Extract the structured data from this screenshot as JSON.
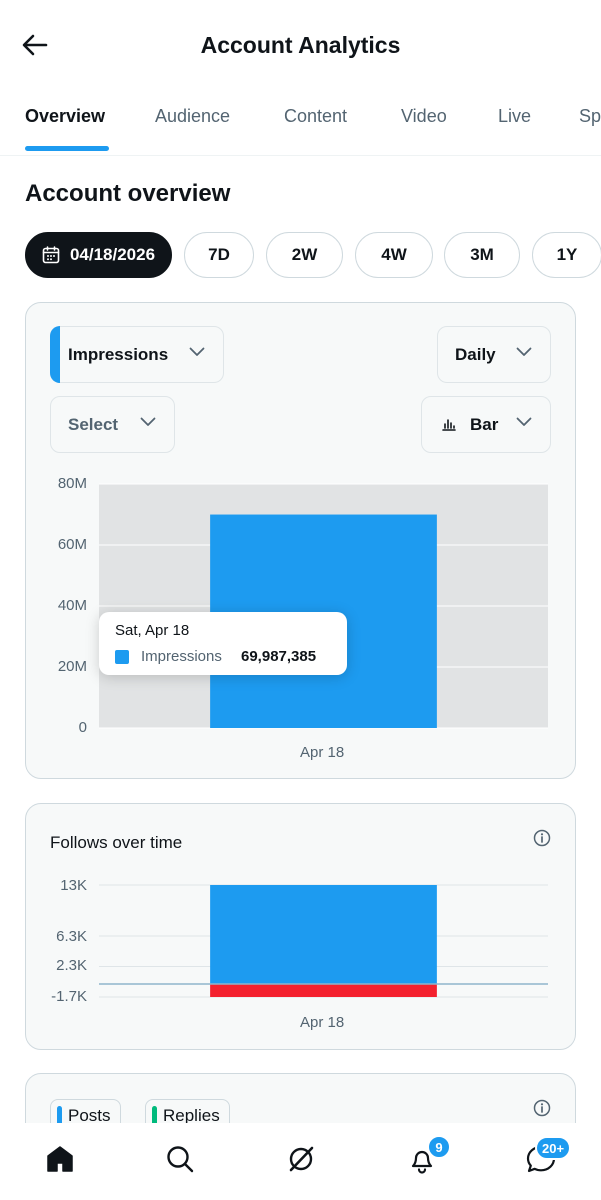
{
  "header": {
    "title": "Account Analytics",
    "back_icon": "arrow-left-icon"
  },
  "tabs": [
    {
      "label": "Overview",
      "active": true
    },
    {
      "label": "Audience",
      "active": false
    },
    {
      "label": "Content",
      "active": false
    },
    {
      "label": "Video",
      "active": false
    },
    {
      "label": "Live",
      "active": false
    },
    {
      "label": "Sp",
      "active": false
    }
  ],
  "section_title": "Account overview",
  "ranges": [
    {
      "label": "04/18/2026",
      "icon": "calendar-icon",
      "active": true
    },
    {
      "label": "7D",
      "active": false
    },
    {
      "label": "2W",
      "active": false
    },
    {
      "label": "4W",
      "active": false
    },
    {
      "label": "3M",
      "active": false
    },
    {
      "label": "1Y",
      "active": false
    }
  ],
  "overview_card": {
    "metric_select": "Impressions",
    "interval_select": "Daily",
    "compare_select": "Select",
    "chart_type_select": "Bar",
    "tooltip": {
      "date": "Sat, Apr 18",
      "series": "Impressions",
      "value": "69,987,385"
    }
  },
  "follows_card": {
    "title": "Follows over time",
    "info_icon": "info-icon"
  },
  "posts_card": {
    "legend": [
      "Posts",
      "Replies"
    ],
    "info_icon": "info-icon"
  },
  "colors": {
    "accent": "#1d9bf0",
    "negative": "#f4212e",
    "text": "#0f1419",
    "muted": "#536471",
    "plot_bg": "#e1e3e4",
    "posts": "#1d9bf0",
    "replies": "#00ba7c"
  },
  "chart_data": [
    {
      "type": "bar",
      "categories": [
        "Apr 18"
      ],
      "series": [
        {
          "name": "Impressions",
          "values": [
            69987385
          ]
        }
      ],
      "yticks": [
        "80M",
        "60M",
        "40M",
        "20M",
        "0"
      ],
      "ylim": [
        0,
        80000000
      ],
      "grid": true
    },
    {
      "type": "bar",
      "title": "Follows over time",
      "categories": [
        "Apr 18"
      ],
      "series": [
        {
          "values": [
            13000
          ]
        },
        {
          "values": [
            -1700
          ]
        }
      ],
      "yticks": [
        "13K",
        "6.3K",
        "2.3K",
        "-1.7K"
      ],
      "ylim": [
        -1700,
        13000
      ],
      "grid": true
    }
  ],
  "bottom_nav": [
    {
      "icon": "home-icon",
      "active": true
    },
    {
      "icon": "search-icon"
    },
    {
      "icon": "grok-icon"
    },
    {
      "icon": "bell-icon",
      "badge": "9"
    },
    {
      "icon": "messages-icon",
      "badge": "20+"
    }
  ]
}
